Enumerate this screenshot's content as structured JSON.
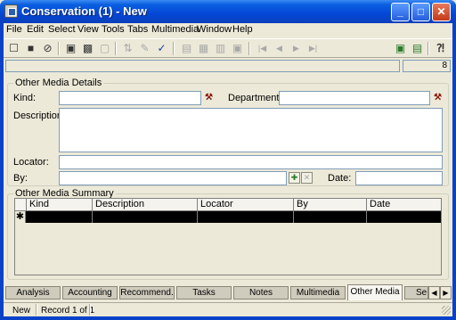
{
  "window": {
    "title": "Conservation (1) - New",
    "controls": {
      "minimize": "_",
      "maximize": "□",
      "close": "✕"
    }
  },
  "menu": [
    "File",
    "Edit",
    "Select",
    "View",
    "Tools",
    "Tabs",
    "Multimedia",
    "Window",
    "Help"
  ],
  "toolbar": {
    "buttons": [
      {
        "name": "new-record",
        "icon": "☐",
        "enabled": true
      },
      {
        "name": "save",
        "icon": "■",
        "enabled": true
      },
      {
        "name": "cancel",
        "icon": "⊘",
        "enabled": true
      },
      {
        "name": "add-to-list",
        "icon": "▣",
        "enabled": true
      },
      {
        "name": "remove-from-list",
        "icon": "▩",
        "enabled": true
      },
      {
        "name": "copy-record",
        "icon": "▢",
        "enabled": false
      },
      {
        "name": "sort",
        "icon": "⇅",
        "enabled": false
      },
      {
        "name": "edit-field",
        "icon": "✎",
        "enabled": false
      },
      {
        "name": "spell-check",
        "icon": "✓",
        "enabled": true
      },
      {
        "name": "view-1",
        "icon": "▤",
        "enabled": false
      },
      {
        "name": "view-2",
        "icon": "▦",
        "enabled": false
      },
      {
        "name": "view-3",
        "icon": "▥",
        "enabled": false
      },
      {
        "name": "view-4",
        "icon": "▣",
        "enabled": false
      },
      {
        "name": "first-record",
        "icon": "|◀",
        "enabled": false
      },
      {
        "name": "prev-record",
        "icon": "◀",
        "enabled": false
      },
      {
        "name": "next-record",
        "icon": "▶",
        "enabled": false
      },
      {
        "name": "last-record",
        "icon": "▶|",
        "enabled": false
      },
      {
        "name": "report-1",
        "icon": "▣",
        "enabled": true
      },
      {
        "name": "report-2",
        "icon": "▤",
        "enabled": true
      },
      {
        "name": "context-help",
        "icon": "⁈",
        "enabled": true
      }
    ]
  },
  "record_count": "8",
  "details": {
    "legend": "Other Media Details",
    "kind_label": "Kind:",
    "kind_value": "",
    "department_label": "Department:",
    "department_value": "",
    "description_label": "Description:",
    "description_value": "",
    "locator_label": "Locator:",
    "locator_value": "",
    "by_label": "By:",
    "by_value": "",
    "date_label": "Date:",
    "date_value": ""
  },
  "summary": {
    "legend": "Other Media Summary",
    "columns": [
      "Kind",
      "Description",
      "Locator",
      "By",
      "Date"
    ],
    "new_row_marker": "✱"
  },
  "tabs": [
    {
      "label": "Analysis",
      "active": false
    },
    {
      "label": "Accounting",
      "active": false
    },
    {
      "label": "Recommend.",
      "active": false
    },
    {
      "label": "Tasks",
      "active": false
    },
    {
      "label": "Notes",
      "active": false
    },
    {
      "label": "Multimedia",
      "active": false
    },
    {
      "label": "Other Media",
      "active": true
    },
    {
      "label": "Se",
      "active": false
    }
  ],
  "status": {
    "mode": "New",
    "record": "Record 1 of 1"
  }
}
